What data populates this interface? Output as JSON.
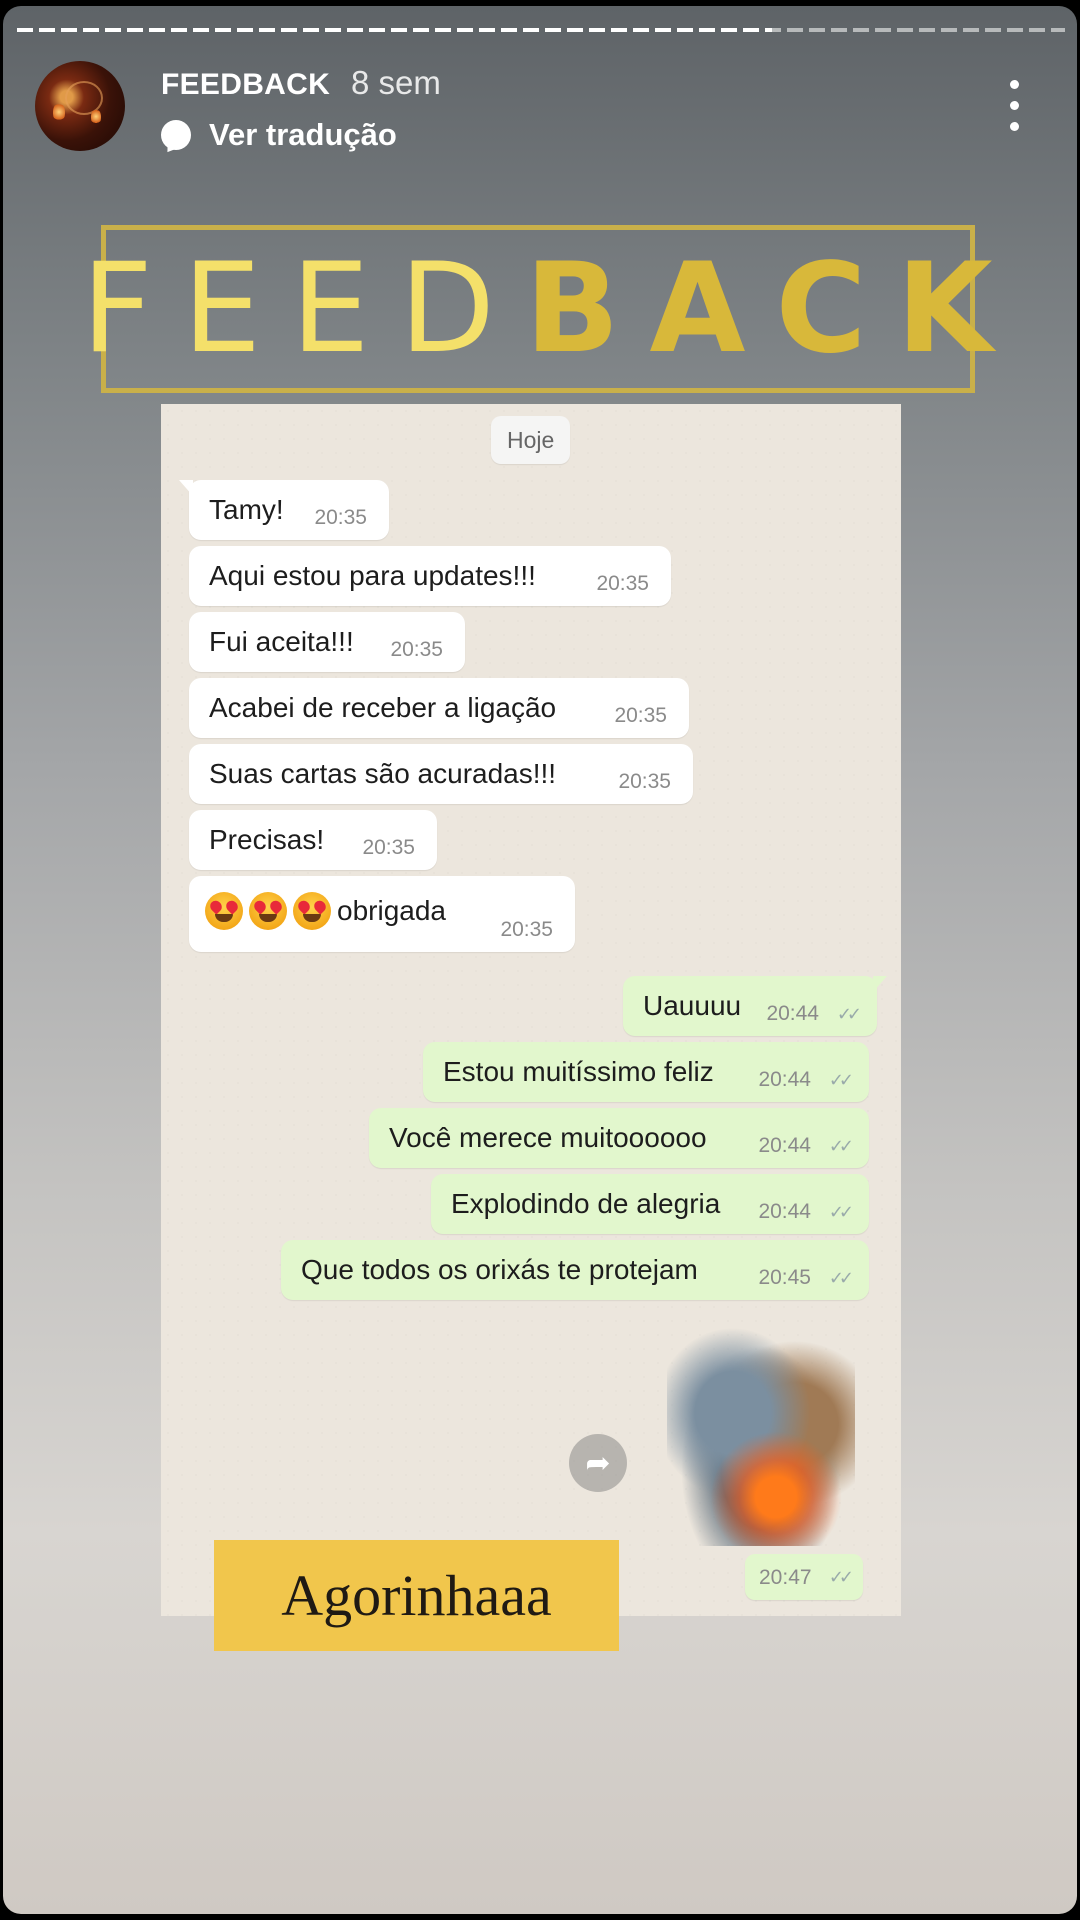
{
  "story": {
    "progress_fraction": 0.72,
    "username": "FEEDBACK",
    "time_ago": "8 sem",
    "translate_label": "Ver tradução",
    "title_light": "FEED",
    "title_bold": "BACK",
    "accent_gold": "#c9b04a",
    "caption": "Agorinhaaa",
    "caption_bg": "#f1c64c"
  },
  "chat": {
    "date_label": "Hoje",
    "incoming": [
      {
        "text": "Tamy!",
        "time": "20:35"
      },
      {
        "text": "Aqui estou para updates!!!",
        "time": "20:35"
      },
      {
        "text": "Fui aceita!!!",
        "time": "20:35"
      },
      {
        "text": "Acabei de receber a ligação",
        "time": "20:35"
      },
      {
        "text": "Suas cartas são acuradas!!!",
        "time": "20:35"
      },
      {
        "text": "Precisas!",
        "time": "20:35"
      },
      {
        "text": "obrigada",
        "time": "20:35",
        "emoji": "heart-eyes-emoji x3"
      }
    ],
    "outgoing": [
      {
        "text": "Uauuuu",
        "time": "20:44"
      },
      {
        "text": "Estou muitíssimo feliz",
        "time": "20:44"
      },
      {
        "text": "Você merece muitoooooo",
        "time": "20:44"
      },
      {
        "text": "Explodindo de alegria",
        "time": "20:44"
      },
      {
        "text": "Que todos os orixás te protejam",
        "time": "20:45"
      }
    ],
    "sticker_time": "20:47",
    "read_ticks": "✓✓",
    "outgoing_bubble_color": "#e2f7cd",
    "incoming_bubble_color": "#ffffff"
  }
}
